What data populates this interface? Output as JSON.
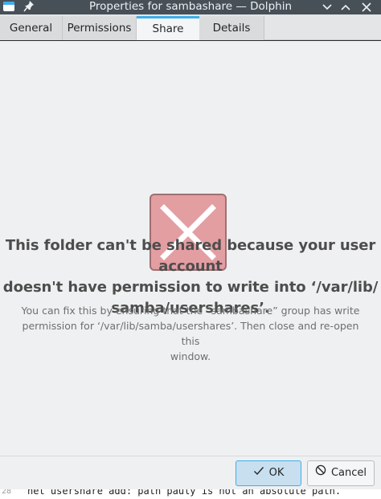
{
  "window": {
    "title": "Properties for sambashare — Dolphin",
    "app_icon": "folder-icon",
    "pin_icon": "pin-icon",
    "controls": [
      "chevron-down-icon",
      "chevron-up-icon",
      "close-icon"
    ]
  },
  "tabs": [
    {
      "label": "General",
      "active": false
    },
    {
      "label": "Permissions",
      "active": false
    },
    {
      "label": "Share",
      "active": true
    },
    {
      "label": "Details",
      "active": false
    }
  ],
  "content": {
    "icon": "error-x-icon",
    "headline_lines": [
      "This folder can't be shared because your user account",
      "doesn't have permission to write into ‘/var/lib/",
      "samba/usershares’."
    ],
    "hint_lines": [
      "You can fix this by ensuring that the “sambashare” group has write",
      "permission for ‘/var/lib/samba/usershares’. Then close and re-open this",
      "window."
    ]
  },
  "buttons": {
    "ok": {
      "label": "OK",
      "icon": "checkmark-icon"
    },
    "cancel": {
      "label": "Cancel",
      "icon": "cancel-icon"
    }
  },
  "background_terminal": {
    "line_number": "28",
    "text": "net usershare add: path pauly is not an absolute path."
  },
  "colors": {
    "accent": "#3daee9",
    "titlebar": "#475057",
    "error_icon_fill": "#e39ea2"
  }
}
